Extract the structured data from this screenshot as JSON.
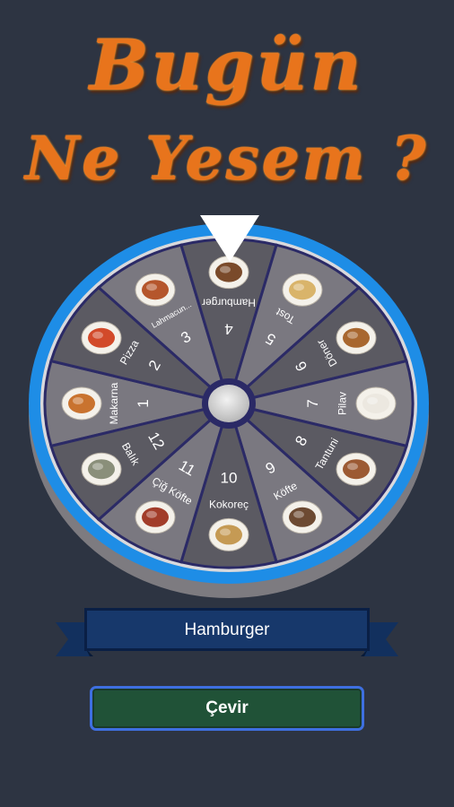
{
  "title": {
    "line1": "Bugün",
    "line2": "Ne Yesem ?"
  },
  "wheel": {
    "segments": [
      {
        "number": "1",
        "label": "Makarna",
        "food_icon": "pasta-icon"
      },
      {
        "number": "2",
        "label": "Pizza",
        "food_icon": "pizza-icon"
      },
      {
        "number": "3",
        "label": "Lahmacun...",
        "food_icon": "lahmacun-icon"
      },
      {
        "number": "4",
        "label": "Hamburger",
        "food_icon": "hamburger-icon"
      },
      {
        "number": "5",
        "label": "Tost",
        "food_icon": "toast-icon"
      },
      {
        "number": "6",
        "label": "Döner",
        "food_icon": "doner-icon"
      },
      {
        "number": "7",
        "label": "Pilav",
        "food_icon": "rice-icon"
      },
      {
        "number": "8",
        "label": "Tantuni",
        "food_icon": "tantuni-icon"
      },
      {
        "number": "9",
        "label": "Köfte",
        "food_icon": "kofte-icon"
      },
      {
        "number": "10",
        "label": "Kokoreç",
        "food_icon": "kokorec-icon"
      },
      {
        "number": "11",
        "label": "Çiğ Köfte",
        "food_icon": "cig-kofte-icon"
      },
      {
        "number": "12",
        "label": "Balık",
        "food_icon": "fish-icon"
      }
    ],
    "colors": {
      "rim": "#1e8de6",
      "segment_light": "#7a7880",
      "segment_dark": "#5b5a62",
      "divider": "#2b2a66",
      "hub": "#d6d6d6"
    }
  },
  "result": {
    "value": "Hamburger"
  },
  "spin_button": {
    "label": "Çevir"
  }
}
